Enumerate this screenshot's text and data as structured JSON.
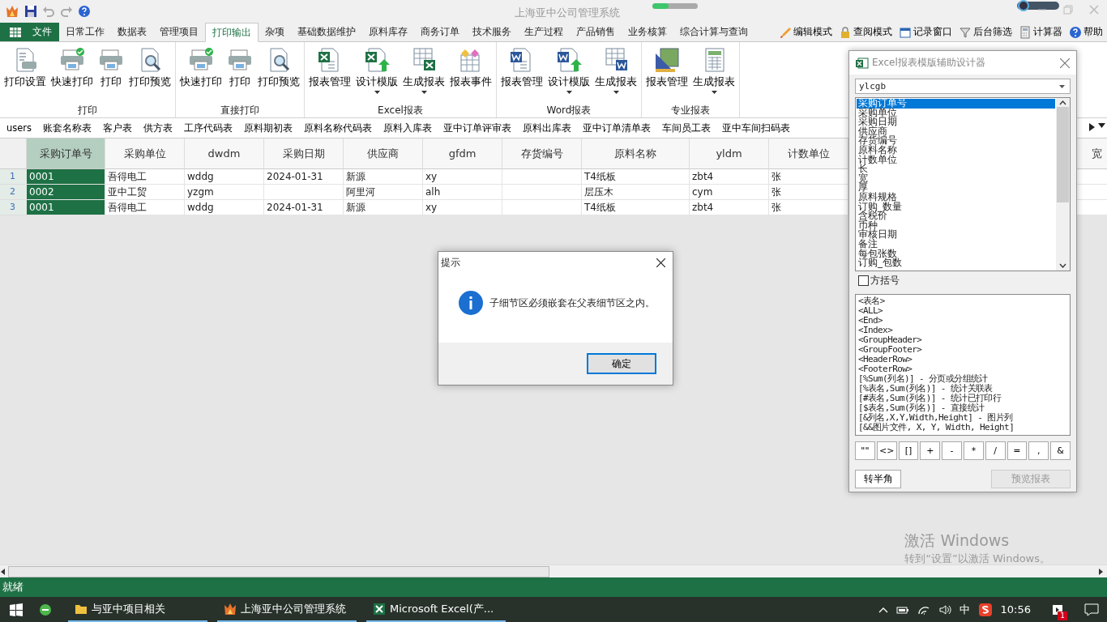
{
  "window": {
    "title": "上海亚中公司管理系统",
    "progress": {
      "level": 0.35
    },
    "zoom_slider": {
      "level": 0.06
    }
  },
  "menu": {
    "file_tab": "文件",
    "tabs": [
      {
        "label": "日常工作",
        "selected": false
      },
      {
        "label": "数据表",
        "selected": false
      },
      {
        "label": "管理项目",
        "selected": false
      },
      {
        "label": "打印输出",
        "selected": true
      },
      {
        "label": "杂项",
        "selected": false
      },
      {
        "label": "基础数据维护",
        "selected": false
      },
      {
        "label": "原料库存",
        "selected": false
      },
      {
        "label": "商务订单",
        "selected": false
      },
      {
        "label": "技术服务",
        "selected": false
      },
      {
        "label": "生产过程",
        "selected": false
      },
      {
        "label": "产品销售",
        "selected": false
      },
      {
        "label": "业务核算",
        "selected": false
      },
      {
        "label": "综合计算与查询",
        "selected": false
      }
    ],
    "tools": [
      {
        "kind": "pencil",
        "label": "编辑模式"
      },
      {
        "kind": "lock",
        "label": "查阅模式"
      },
      {
        "kind": "window",
        "label": "记录窗口"
      },
      {
        "kind": "funnel",
        "label": "后台筛选"
      },
      {
        "kind": "calculator",
        "label": "计算器"
      },
      {
        "kind": "help",
        "label": "帮助"
      }
    ]
  },
  "ribbon": {
    "groups": [
      {
        "label": "打印",
        "buttons": [
          {
            "kind": "settings",
            "label": "打印设置",
            "dropdown": false
          },
          {
            "kind": "printcheck",
            "label": "快速打印",
            "dropdown": false
          },
          {
            "kind": "printer",
            "label": "打印",
            "dropdown": false
          },
          {
            "kind": "preview",
            "label": "打印预览",
            "dropdown": false
          }
        ]
      },
      {
        "label": "直接打印",
        "buttons": [
          {
            "kind": "printcheck",
            "label": "快速打印",
            "dropdown": false
          },
          {
            "kind": "printer",
            "label": "打印",
            "dropdown": false
          },
          {
            "kind": "preview",
            "label": "打印预览",
            "dropdown": false
          }
        ]
      },
      {
        "label": "Excel报表",
        "buttons": [
          {
            "kind": "excel",
            "label": "报表管理",
            "dropdown": false
          },
          {
            "kind": "exceldesign",
            "label": "设计模版",
            "dropdown": true
          },
          {
            "kind": "excelgrid",
            "label": "生成报表",
            "dropdown": true
          },
          {
            "kind": "event",
            "label": "报表事件",
            "dropdown": false
          }
        ]
      },
      {
        "label": "Word报表",
        "buttons": [
          {
            "kind": "word",
            "label": "报表管理",
            "dropdown": false
          },
          {
            "kind": "worddesign",
            "label": "设计模版",
            "dropdown": true
          },
          {
            "kind": "wordgrid",
            "label": "生成报表",
            "dropdown": true
          }
        ]
      },
      {
        "label": "专业报表",
        "buttons": [
          {
            "kind": "ruler",
            "label": "报表管理",
            "dropdown": false
          },
          {
            "kind": "sheet",
            "label": "生成报表",
            "dropdown": true
          }
        ]
      }
    ]
  },
  "sheet_tabs": [
    "users",
    "账套名称表",
    "客户表",
    "供方表",
    "工序代码表",
    "原料期初表",
    "原料名称代码表",
    "原料入库表",
    "亚中订单评审表",
    "原料出库表",
    "亚中订单清单表",
    "车间员工表",
    "亚中车间扫码表"
  ],
  "table": {
    "columns": [
      {
        "label": "采购订单号",
        "selected": true
      },
      {
        "label": "采购单位",
        "selected": false
      },
      {
        "label": "dwdm",
        "selected": false
      },
      {
        "label": "采购日期",
        "selected": false
      },
      {
        "label": "供应商",
        "selected": false
      },
      {
        "label": "gfdm",
        "selected": false
      },
      {
        "label": "存货编号",
        "selected": false
      },
      {
        "label": "原料名称",
        "selected": false
      },
      {
        "label": "yldm",
        "selected": false
      },
      {
        "label": "计数单位",
        "selected": false
      },
      {
        "label": "宽",
        "selected": false
      }
    ],
    "rows": [
      {
        "number": "1",
        "cells": [
          "0001",
          "吾得电工",
          "wddg",
          "2024-01-31",
          "新源",
          "xy",
          null,
          "T4纸板",
          "zbt4",
          "张",
          null
        ]
      },
      {
        "number": "2",
        "cells": [
          "0002",
          "亚中工贸",
          "yzgm",
          null,
          "阿里河",
          "alh",
          null,
          "层压木",
          "cym",
          "张",
          null
        ]
      },
      {
        "number": "3",
        "cells": [
          "0001",
          "吾得电工",
          "wddg",
          "2024-01-31",
          "新源",
          "xy",
          null,
          "T4纸板",
          "zbt4",
          "张",
          null
        ]
      }
    ]
  },
  "dialog": {
    "title": "提示",
    "message": "子细节区必须嵌套在父表细节区之内。",
    "button": "确定"
  },
  "panel": {
    "title": "Excel报表模版辅助设计器",
    "table_select": "ylcgb",
    "fields": [
      {
        "label": "采购订单号",
        "selected": true
      },
      {
        "label": "采购单位",
        "selected": false
      },
      {
        "label": "采购日期",
        "selected": false
      },
      {
        "label": "供应商",
        "selected": false
      },
      {
        "label": "存货编号",
        "selected": false
      },
      {
        "label": "原料名称",
        "selected": false
      },
      {
        "label": "计数单位",
        "selected": false
      },
      {
        "label": "长",
        "selected": false
      },
      {
        "label": "宽",
        "selected": false
      },
      {
        "label": "厚",
        "selected": false
      },
      {
        "label": "原料规格",
        "selected": false
      },
      {
        "label": "订购_数量",
        "selected": false
      },
      {
        "label": "含税价",
        "selected": false
      },
      {
        "label": "币种",
        "selected": false
      },
      {
        "label": "审核日期",
        "selected": false
      },
      {
        "label": "备注",
        "selected": false
      },
      {
        "label": "每包张数",
        "selected": false
      },
      {
        "label": "订购_包数",
        "selected": false
      }
    ],
    "bracket_option": {
      "label": "方括号",
      "checked": false
    },
    "snippets": [
      "<表名>",
      "<ALL>",
      "<End>",
      "<Index>",
      "<GroupHeader>",
      "<GroupFooter>",
      "<HeaderRow>",
      "<FooterRow>",
      "[%Sum(列名)] - 分页或分组统计",
      "[%表名,Sum(列名)] - 统计关联表",
      "[#表名,Sum(列名)] - 统计已打印行",
      "[$表名,Sum(列名)] - 直接统计",
      "[&列名,X,Y,Width,Height] - 图片列",
      "[&&图片文件, X, Y, Width, Height]"
    ],
    "symbols": [
      "\"\"",
      "<>",
      "[]",
      "+",
      "-",
      "*",
      "/",
      "=",
      ",",
      "&"
    ],
    "buttons": [
      {
        "label": "转半角",
        "disabled": false
      },
      {
        "label": "预览报表",
        "disabled": true
      }
    ]
  },
  "status_bar": {
    "text": "就绪"
  },
  "activation_notice": {
    "title": "激活 Windows",
    "subtitle": "转到“设置”以激活 Windows。"
  },
  "taskbar": {
    "items": [
      {
        "kind": "folder",
        "label": "与亚中项目相关"
      },
      {
        "kind": "app",
        "label": "上海亚中公司管理系统"
      },
      {
        "kind": "excel",
        "label": "Microsoft Excel(产..."
      }
    ],
    "ime": "中",
    "time": "10:56",
    "notification_count": "1"
  }
}
